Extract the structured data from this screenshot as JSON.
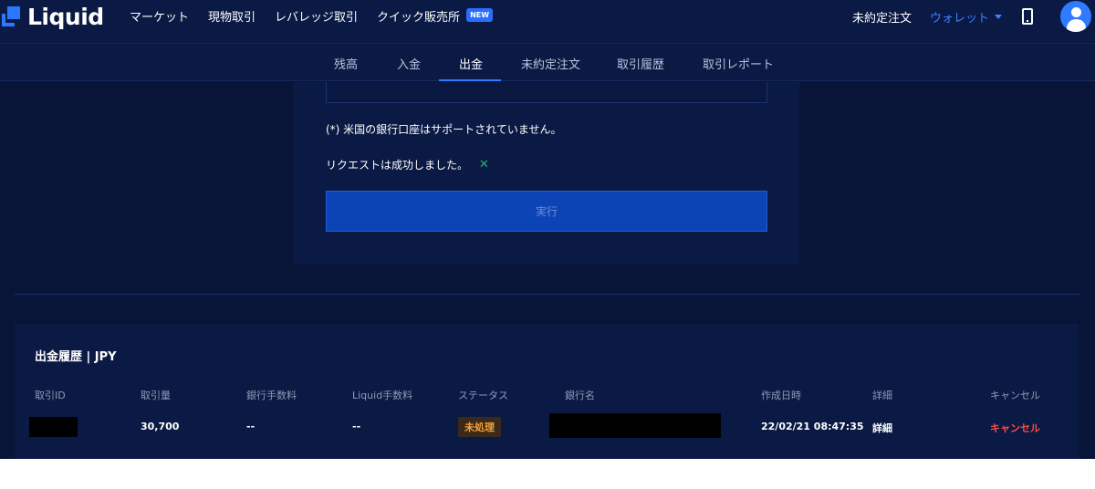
{
  "brand": {
    "name": "Liquid",
    "accent": "#2a78ff"
  },
  "nav": {
    "links": [
      "マーケット",
      "現物取引",
      "レバレッジ取引",
      "クイック販売所"
    ],
    "new_badge": "NEW",
    "open_orders": "未約定注文",
    "wallet": "ウォレット"
  },
  "tabs": [
    "残高",
    "入金",
    "出金",
    "未約定注文",
    "取引履歴",
    "取引レポート"
  ],
  "active_tab": "出金",
  "form": {
    "note": "(*) 米国の銀行口座はサポートされていません。",
    "success_message": "リクエストは成功しました。",
    "success_icon": "✕",
    "execute_label": "実行"
  },
  "history": {
    "title": "出金履歴 | JPY",
    "columns": [
      "取引ID",
      "取引量",
      "銀行手数料",
      "Liquid手数料",
      "ステータス",
      "銀行名",
      "作成日時",
      "詳細",
      "キャンセル"
    ],
    "rows": [
      {
        "amount": "30,700",
        "bank_fee": "--",
        "liquid_fee": "--",
        "status": "未処理",
        "created_at": "22/02/21 08:47:35",
        "detail": "詳細",
        "cancel": "キャンセル"
      }
    ]
  },
  "colors": {
    "background": "#081538",
    "panel": "#0b1a44",
    "button": "#0d44b5",
    "status_pending": "#f2a03d",
    "cancel": "#ff4b3e",
    "success": "#26b36b"
  }
}
